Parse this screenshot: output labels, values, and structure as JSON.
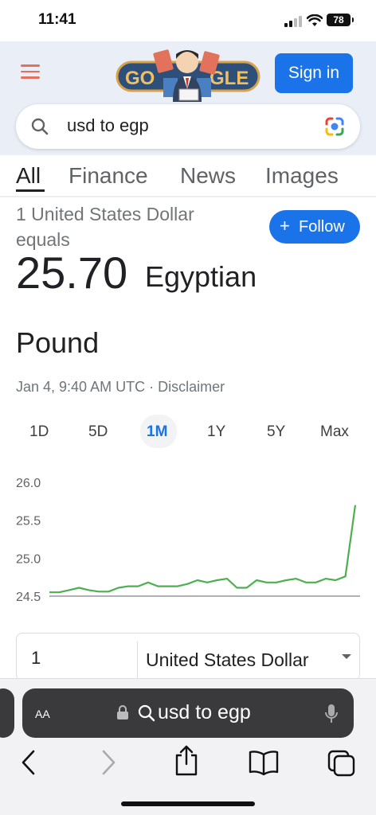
{
  "status_bar": {
    "time": "11:41",
    "battery": "78"
  },
  "header": {
    "menu_icon": "hamburger-menu-icon",
    "doodle": "Google doodle",
    "doodle_letters_left": "GO",
    "doodle_letters_right": "GLE",
    "sign_in_label": "Sign in"
  },
  "search": {
    "query": "usd to egp",
    "search_icon": "search-icon",
    "lens_icon": "google-lens-icon"
  },
  "tabs": [
    "All",
    "Finance",
    "News",
    "Images"
  ],
  "active_tab": "All",
  "result": {
    "equals_line1": "1 United States Dollar",
    "equals_line2": "equals",
    "rate": "25.70",
    "currency_line1": "Egyptian",
    "currency_line2": "Pound",
    "timestamp": "Jan 4, 9:40 AM UTC · ",
    "disclaimer": "Disclaimer",
    "follow_label": "Follow",
    "follow_icon": "plus-icon"
  },
  "ranges": [
    "1D",
    "5D",
    "1M",
    "1Y",
    "5Y",
    "Max"
  ],
  "active_range": "1M",
  "chart_data": {
    "type": "line",
    "title": "",
    "xlabel": "",
    "ylabel": "",
    "ylim": [
      24.5,
      26.0
    ],
    "yticks": [
      "26.0",
      "25.5",
      "25.0",
      "24.5"
    ],
    "grid": true,
    "baseline": 24.5,
    "color": "#4caf50",
    "series": [
      {
        "values": [
          24.55,
          24.55,
          24.58,
          24.61,
          24.58,
          24.56,
          24.56,
          24.61,
          24.63,
          24.63,
          24.68,
          24.63,
          24.63,
          24.63,
          24.66,
          24.71,
          24.68,
          24.71,
          24.73,
          24.61,
          24.61,
          24.71,
          24.68,
          24.68,
          24.71,
          24.73,
          24.68,
          24.68,
          24.73,
          24.71,
          24.76,
          25.7
        ]
      }
    ]
  },
  "converter": {
    "amount": "1",
    "currency": "United States Dollar"
  },
  "safari": {
    "text_size_label": "AA",
    "url_text": "usd to egp",
    "lock_icon": "lock-icon",
    "mic_icon": "microphone-icon",
    "toolbar": [
      "back-icon",
      "forward-icon",
      "share-icon",
      "bookmarks-icon",
      "tabs-icon"
    ]
  },
  "colors": {
    "accent": "#1a73e8",
    "header_bg": "#e9eef7",
    "chart_line": "#4caf50",
    "menu": "#e2725b"
  }
}
